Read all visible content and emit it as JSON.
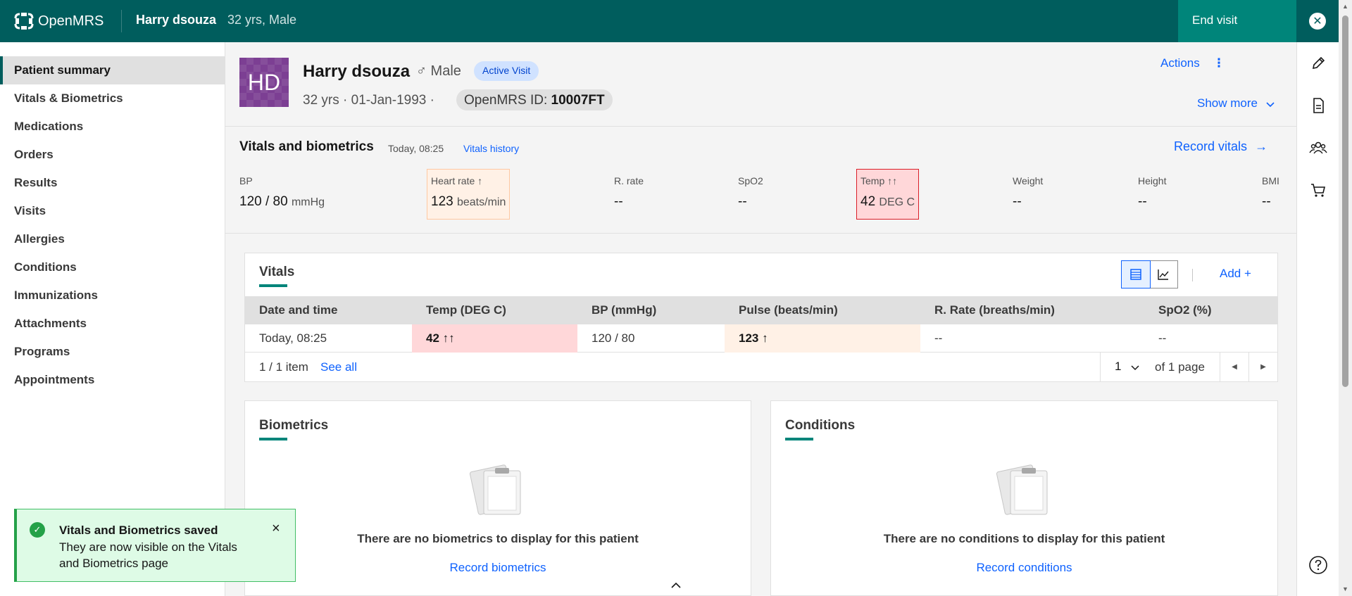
{
  "topbar": {
    "app_name": "OpenMRS",
    "patient_name": "Harry dsouza",
    "patient_meta": "32 yrs, Male",
    "end_visit": "End visit"
  },
  "nav": {
    "items": [
      {
        "label": "Patient summary",
        "active": true
      },
      {
        "label": "Vitals & Biometrics"
      },
      {
        "label": "Medications"
      },
      {
        "label": "Orders"
      },
      {
        "label": "Results"
      },
      {
        "label": "Visits"
      },
      {
        "label": "Allergies"
      },
      {
        "label": "Conditions"
      },
      {
        "label": "Immunizations"
      },
      {
        "label": "Attachments"
      },
      {
        "label": "Programs"
      },
      {
        "label": "Appointments"
      }
    ]
  },
  "patient": {
    "initials": "HD",
    "name": "Harry dsouza",
    "gender": "♂ Male",
    "visit_badge": "Active Visit",
    "age": "32 yrs",
    "dob": "01-Jan-1993",
    "id_label": "OpenMRS ID:",
    "id_value": "10007FT",
    "actions": "Actions",
    "show_more": "Show more"
  },
  "vitals_header": {
    "title": "Vitals and biometrics",
    "time": "Today, 08:25",
    "history_link": "Vitals history",
    "record_link": "Record vitals",
    "tiles": [
      {
        "label": "BP",
        "value": "120 / 80",
        "unit": "mmHg"
      },
      {
        "label": "Heart rate ↑",
        "value": "123",
        "unit": "beats/min"
      },
      {
        "label": "R. rate",
        "value": "--",
        "unit": ""
      },
      {
        "label": "SpO2",
        "value": "--",
        "unit": ""
      },
      {
        "label": "Temp ↑↑",
        "value": "42",
        "unit": "DEG C"
      },
      {
        "label": "Weight",
        "value": "--",
        "unit": ""
      },
      {
        "label": "Height",
        "value": "--",
        "unit": ""
      },
      {
        "label": "BMI",
        "value": "--",
        "unit": ""
      }
    ]
  },
  "vitals_table": {
    "title": "Vitals",
    "add": "Add +",
    "columns": [
      "Date and time",
      "Temp (DEG C)",
      "BP (mmHg)",
      "Pulse (beats/min)",
      "R. Rate (breaths/min)",
      "SpO2 (%)"
    ],
    "rows": [
      [
        "Today, 08:25",
        "42 ↑↑",
        "120 / 80",
        "123 ↑",
        "--",
        "--"
      ]
    ],
    "count": "1 / 1 item",
    "see_all": "See all",
    "page": "1",
    "of_pages": "of 1 page"
  },
  "biometrics": {
    "title": "Biometrics",
    "empty_msg": "There are no biometrics to display for this patient",
    "link": "Record biometrics"
  },
  "conditions": {
    "title": "Conditions",
    "empty_msg": "There are no conditions to display for this patient",
    "link": "Record conditions"
  },
  "toast": {
    "title": "Vitals and Biometrics saved",
    "body": "They are now visible on the Vitals and Biometrics page"
  },
  "colors": {
    "brand": "#005d5d",
    "end_visit": "#00857a",
    "link": "#0f62fe",
    "critical": "#ffd7d9",
    "warning": "#fff1e6",
    "success": "#24a148"
  }
}
